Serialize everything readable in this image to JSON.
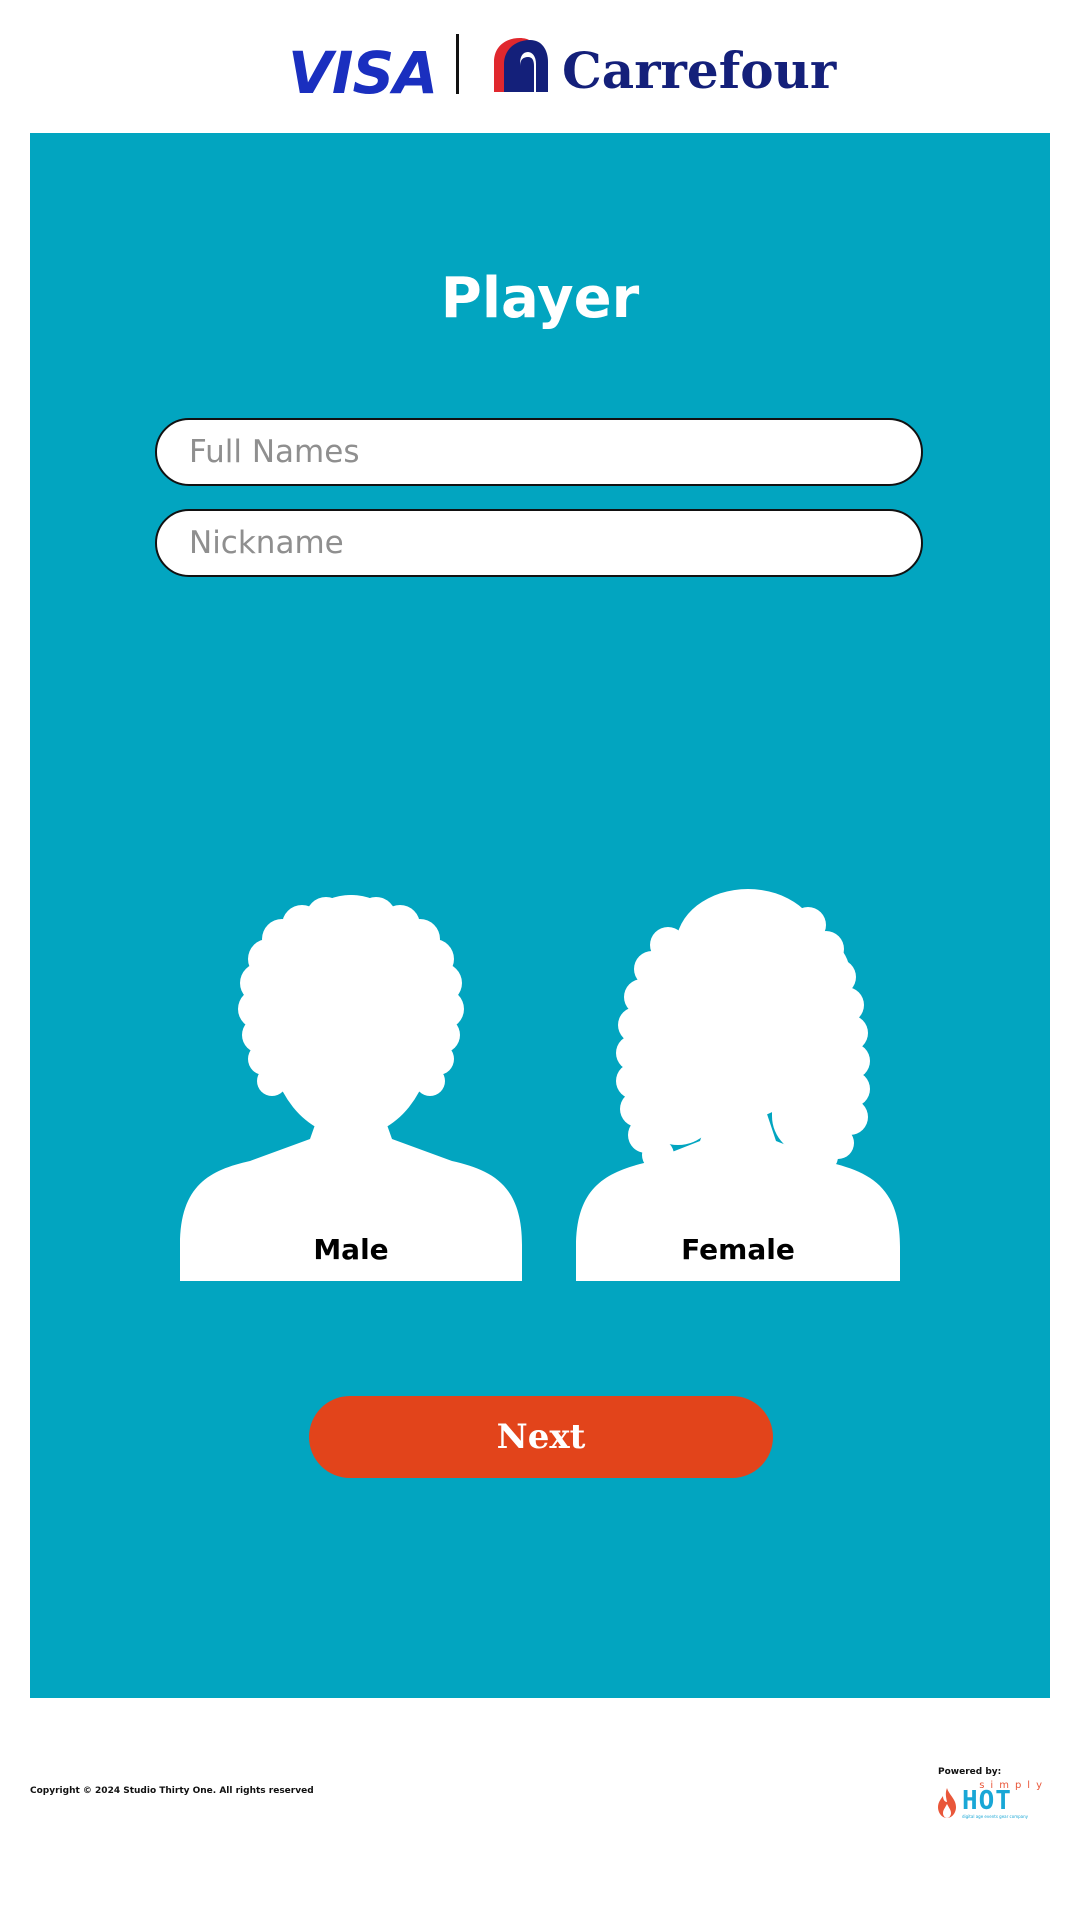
{
  "header": {
    "visa_logo_text": "VISA",
    "carrefour_logo_text": "Carrefour"
  },
  "form": {
    "title": "Player",
    "full_name": {
      "value": "",
      "placeholder": "Full Names"
    },
    "nickname": {
      "value": "",
      "placeholder": "Nickname"
    }
  },
  "avatars": {
    "male_label": "Male",
    "female_label": "Female"
  },
  "actions": {
    "next_label": "Next"
  },
  "footer": {
    "copyright": "Copyright © 2024 Studio Thirty One. All rights reserved",
    "powered_by_label": "Powered by:",
    "powered_by_logo_top": "simply",
    "powered_by_logo_main": "HOT",
    "powered_by_logo_tagline": "digital age events gear company"
  },
  "colors": {
    "panel": "#02a5c0",
    "accent_button": "#e2441b",
    "visa_blue": "#1a2fbf",
    "carrefour_navy": "#14207a",
    "carrefour_red": "#e0282e",
    "avatar_fill": "#ffffff"
  },
  "icons": {
    "male_avatar": "male-silhouette-icon",
    "female_avatar": "female-silhouette-icon",
    "carrefour_mark": "carrefour-arch-icon",
    "flame": "flame-icon"
  }
}
